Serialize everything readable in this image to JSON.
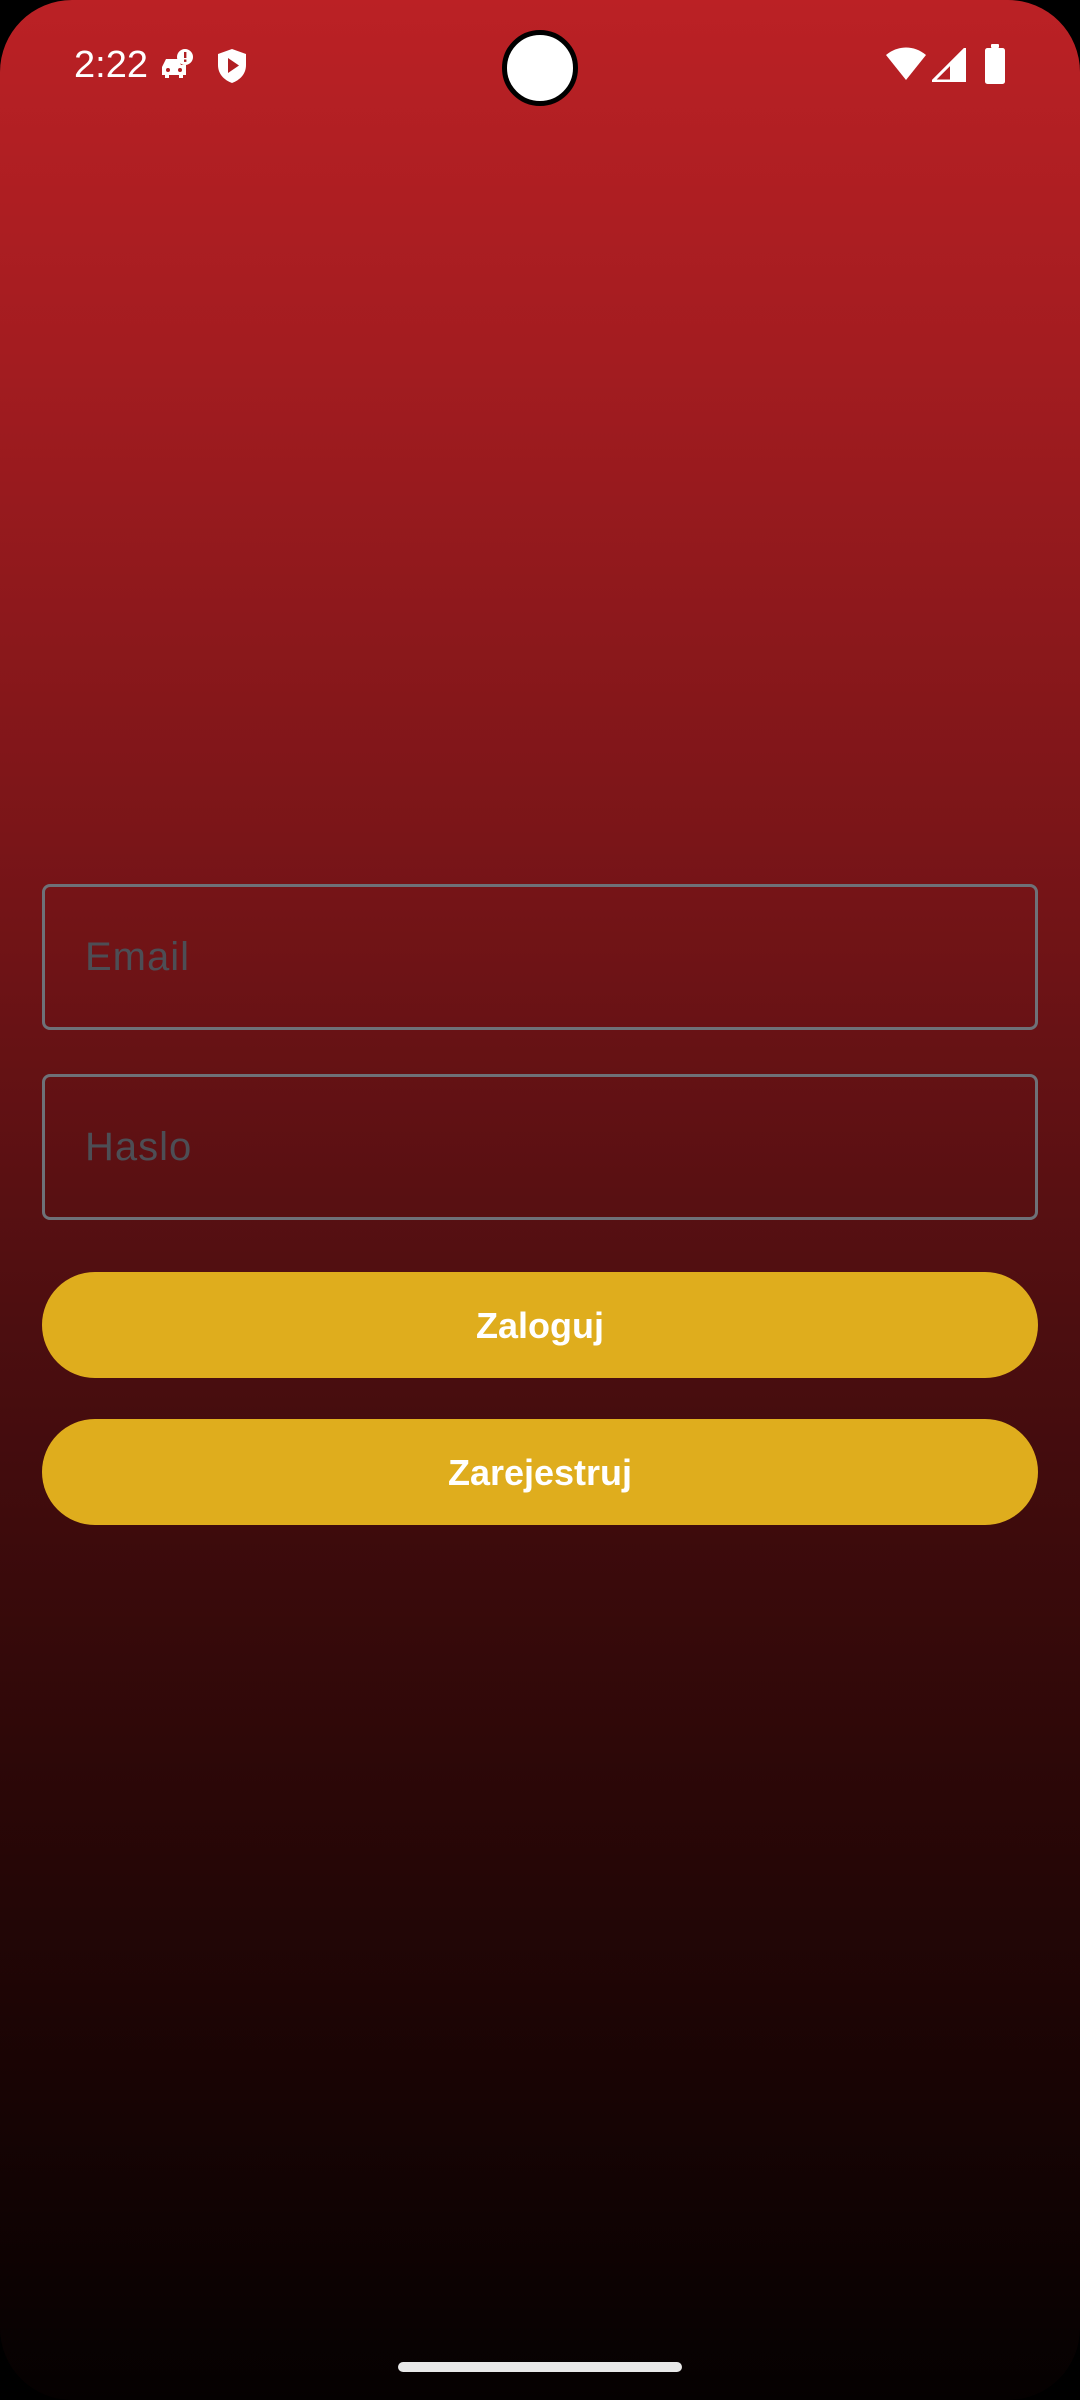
{
  "status_bar": {
    "time": "2:22",
    "left_icons": [
      "car-alert-icon",
      "shield-play-icon"
    ],
    "right_icons": [
      "wifi-icon",
      "cellular-signal-icon",
      "battery-icon"
    ]
  },
  "login_form": {
    "email_placeholder": "Email",
    "email_value": "",
    "password_placeholder": "Haslo",
    "password_value": "",
    "login_label": "Zaloguj",
    "register_label": "Zarejestruj"
  },
  "colors": {
    "gradient_top": "#bb2125",
    "gradient_bottom": "#050101",
    "button_accent": "#dfad1d",
    "field_border": "#6e7178",
    "placeholder": "#4d4e55"
  }
}
